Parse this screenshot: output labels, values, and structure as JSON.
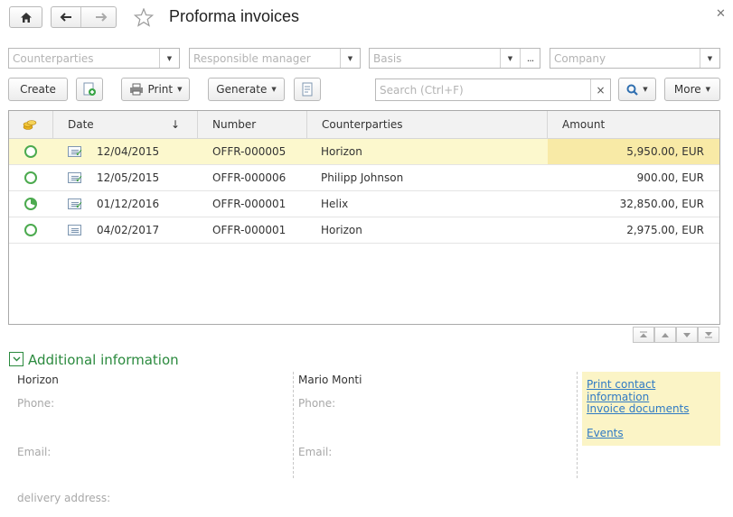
{
  "window": {
    "title": "Proforma invoices"
  },
  "filters": {
    "counterparties_placeholder": "Counterparties",
    "responsible_manager_placeholder": "Responsible manager",
    "basis_placeholder": "Basis",
    "basis_more": "...",
    "company_placeholder": "Company"
  },
  "toolbar": {
    "create_label": "Create",
    "print_label": "Print",
    "generate_label": "Generate",
    "search_placeholder": "Search (Ctrl+F)",
    "clear_label": "×",
    "more_label": "More"
  },
  "table": {
    "columns": [
      "Date",
      "Number",
      "Counterparties",
      "Amount"
    ],
    "sort_indicator": "↓",
    "rows": [
      {
        "date": "12/04/2015",
        "number": "OFFR-000005",
        "counterparty": "Horizon",
        "amount": "5,950.00, EUR",
        "status": "open",
        "doc_posted": true,
        "selected": true
      },
      {
        "date": "12/05/2015",
        "number": "OFFR-000006",
        "counterparty": "Philipp Johnson",
        "amount": "900.00, EUR",
        "status": "open",
        "doc_posted": true,
        "selected": false
      },
      {
        "date": "01/12/2016",
        "number": "OFFR-000001",
        "counterparty": "Helix",
        "amount": "32,850.00, EUR",
        "status": "partial",
        "doc_posted": true,
        "selected": false
      },
      {
        "date": "04/02/2017",
        "number": "OFFR-000001",
        "counterparty": "Horizon",
        "amount": "2,975.00, EUR",
        "status": "open",
        "doc_posted": false,
        "selected": false
      }
    ]
  },
  "additional_info": {
    "title": "Additional information",
    "counterparty_name": "Horizon",
    "contact_name": "Mario Monti",
    "phone_label": "Phone:",
    "email_label": "Email:",
    "delivery_label": "delivery address:",
    "links": [
      "Print contact information",
      "Invoice documents",
      "Events"
    ]
  },
  "colors": {
    "selected_row": "#fcf8cd",
    "selected_amount": "#f8eaa6",
    "accent_green": "#2b8a3e",
    "link_blue": "#2f7ac4",
    "links_panel": "#fbf4c6"
  }
}
